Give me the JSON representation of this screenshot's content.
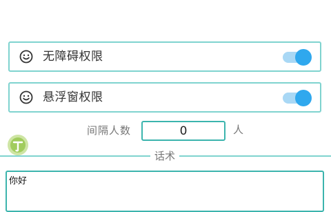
{
  "permissions": [
    {
      "label": "无障碍权限",
      "icon": "smile-icon",
      "enabled": true
    },
    {
      "label": "悬浮窗权限",
      "icon": "smile-icon",
      "enabled": true
    }
  ],
  "interval": {
    "label": "间隔人数",
    "value": "0",
    "unit": "人"
  },
  "script_section": {
    "title": "话术",
    "text": "你好"
  },
  "colors": {
    "border_light": "#7fd3cf",
    "border_dark": "#3bb4ad",
    "toggle_on": "#2fa8ee",
    "toggle_track": "#a9d8f5",
    "float_icon": "#a6cf5a"
  }
}
